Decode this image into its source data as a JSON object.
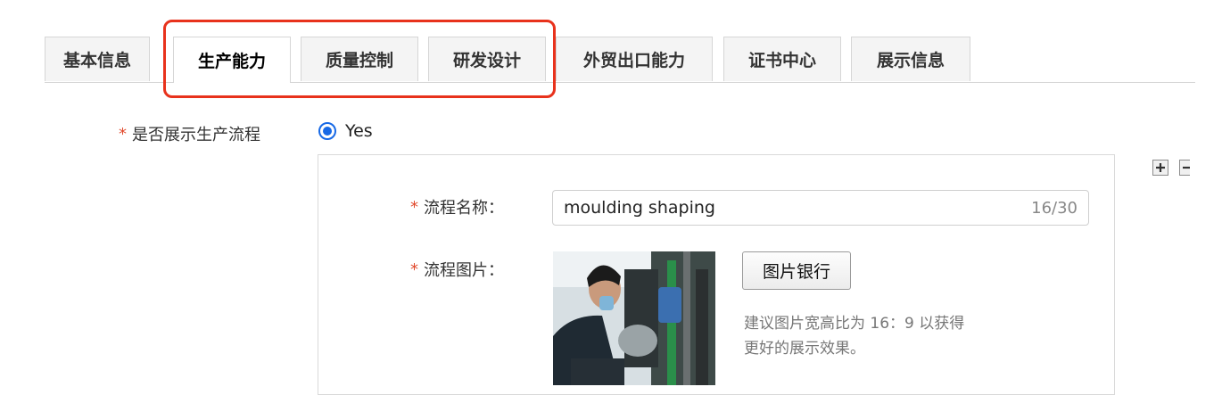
{
  "tabs": [
    {
      "label": "基本信息",
      "active": false
    },
    {
      "label": "生产能力",
      "active": true
    },
    {
      "label": "质量控制",
      "active": false
    },
    {
      "label": "研发设计",
      "active": false
    },
    {
      "label": "外贸出口能力",
      "active": false
    },
    {
      "label": "证书中心",
      "active": false
    },
    {
      "label": "展示信息",
      "active": false
    }
  ],
  "colors": {
    "accent": "#1769e6",
    "highlight": "#e8321c",
    "required": "#e14a2d"
  },
  "show_process": {
    "required_mark": "*",
    "label": "是否展示生产流程",
    "option": "Yes",
    "selected": true
  },
  "process": {
    "name_label": "流程名称：",
    "name_value": "moulding shaping",
    "name_counter": "16/30",
    "image_label": "流程图片：",
    "image_bank_button": "图片银行",
    "hint_line1": "建议图片宽高比为 16：9 以获得",
    "hint_line2": "更好的展示效果。"
  },
  "side_icons": [
    "plus-icon",
    "minus-icon"
  ]
}
